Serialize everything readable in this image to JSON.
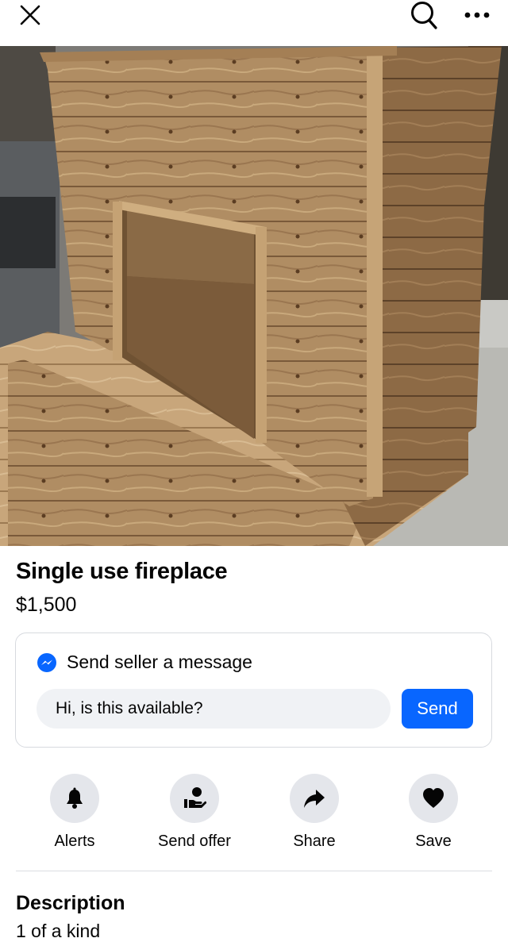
{
  "header": {
    "close_icon": "close-icon",
    "search_icon": "search-icon",
    "more_icon": "more-options-icon"
  },
  "listing": {
    "title": "Single use fireplace",
    "price": "$1,500",
    "image_subject": "wooden-fireplace-photo"
  },
  "message": {
    "heading": "Send seller a message",
    "icon": "messenger-icon",
    "accent": "#0866ff",
    "input_value": "Hi, is this available?",
    "send_label": "Send"
  },
  "actions": [
    {
      "label": "Alerts",
      "icon": "bell-icon"
    },
    {
      "label": "Send offer",
      "icon": "offer-icon"
    },
    {
      "label": "Share",
      "icon": "share-arrow-icon"
    },
    {
      "label": "Save",
      "icon": "heart-icon"
    }
  ],
  "description": {
    "heading": "Description",
    "text": "1 of a kind"
  }
}
